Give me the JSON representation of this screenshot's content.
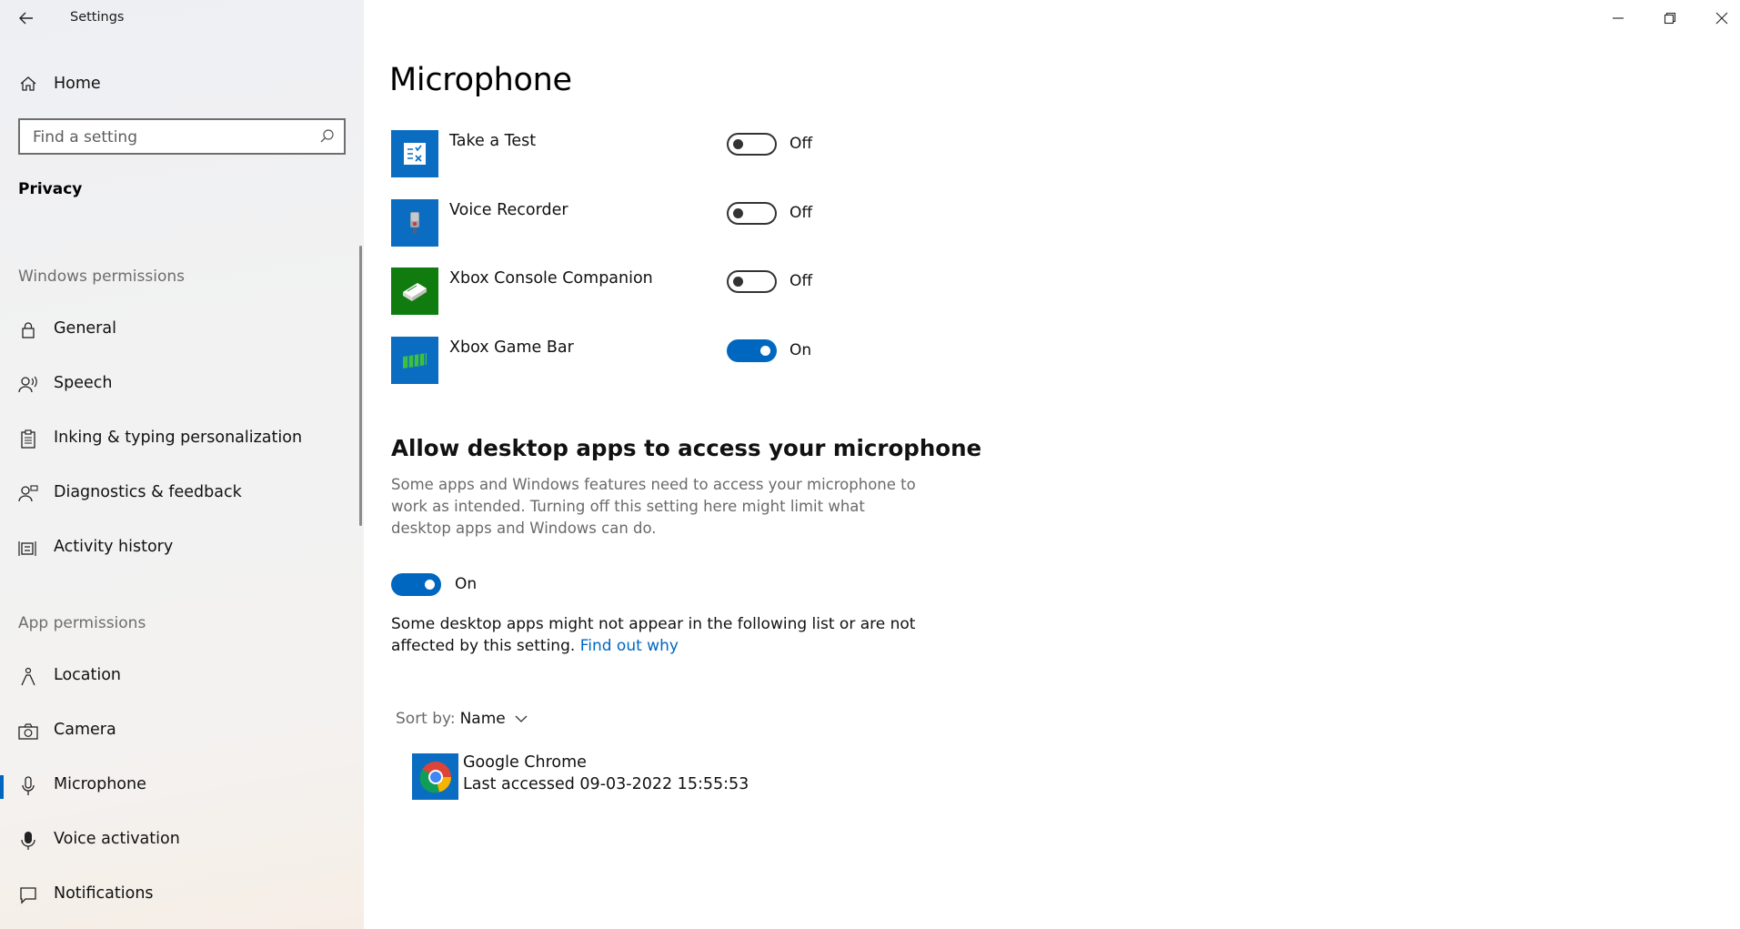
{
  "window": {
    "app_title": "Settings",
    "controls": [
      "minimize",
      "restore",
      "close"
    ]
  },
  "sidebar": {
    "home_label": "Home",
    "search_placeholder": "Find a setting",
    "section_title": "Privacy",
    "groups": [
      {
        "label": "Windows permissions",
        "items": [
          {
            "label": "General",
            "icon": "lock-icon"
          },
          {
            "label": "Speech",
            "icon": "speech-icon"
          },
          {
            "label": "Inking & typing personalization",
            "icon": "clipboard-icon"
          },
          {
            "label": "Diagnostics & feedback",
            "icon": "feedback-person-icon"
          },
          {
            "label": "Activity history",
            "icon": "activity-history-icon"
          }
        ]
      },
      {
        "label": "App permissions",
        "items": [
          {
            "label": "Location",
            "icon": "location-person-icon"
          },
          {
            "label": "Camera",
            "icon": "camera-icon"
          },
          {
            "label": "Microphone",
            "icon": "microphone-icon",
            "selected": true
          },
          {
            "label": "Voice activation",
            "icon": "voice-activation-icon"
          },
          {
            "label": "Notifications",
            "icon": "notification-icon"
          }
        ]
      }
    ]
  },
  "main": {
    "title": "Microphone",
    "apps": [
      {
        "name": "Take a Test",
        "state": "Off",
        "icon": "take-a-test-icon",
        "tile_color": "#0a6dc2"
      },
      {
        "name": "Voice Recorder",
        "state": "Off",
        "icon": "voice-recorder-icon",
        "tile_color": "#0a6dc2"
      },
      {
        "name": "Xbox Console Companion",
        "state": "Off",
        "icon": "xbox-console-icon",
        "tile_color": "#107c10"
      },
      {
        "name": "Xbox Game Bar",
        "state": "On",
        "icon": "xbox-game-bar-icon",
        "tile_color": "#0a6dc2"
      }
    ],
    "desktop_section": {
      "heading": "Allow desktop apps to access your microphone",
      "description": "Some apps and Windows features need to access your microphone to work as intended. Turning off this setting here might limit what desktop apps and Windows can do.",
      "toggle_state": "On",
      "note": "Some desktop apps might not appear in the following list or are not affected by this setting.",
      "link": "Find out why"
    },
    "sort": {
      "label": "Sort by:",
      "value": "Name"
    },
    "desktop_apps": [
      {
        "name": "Google Chrome",
        "last_accessed": "Last accessed 09-03-2022 15:55:53",
        "icon": "chrome-icon"
      }
    ]
  },
  "colors": {
    "accent": "#0067c0",
    "toggle_off_border": "#333333",
    "xbox_green": "#107c10",
    "tile_blue": "#0a6dc2"
  }
}
